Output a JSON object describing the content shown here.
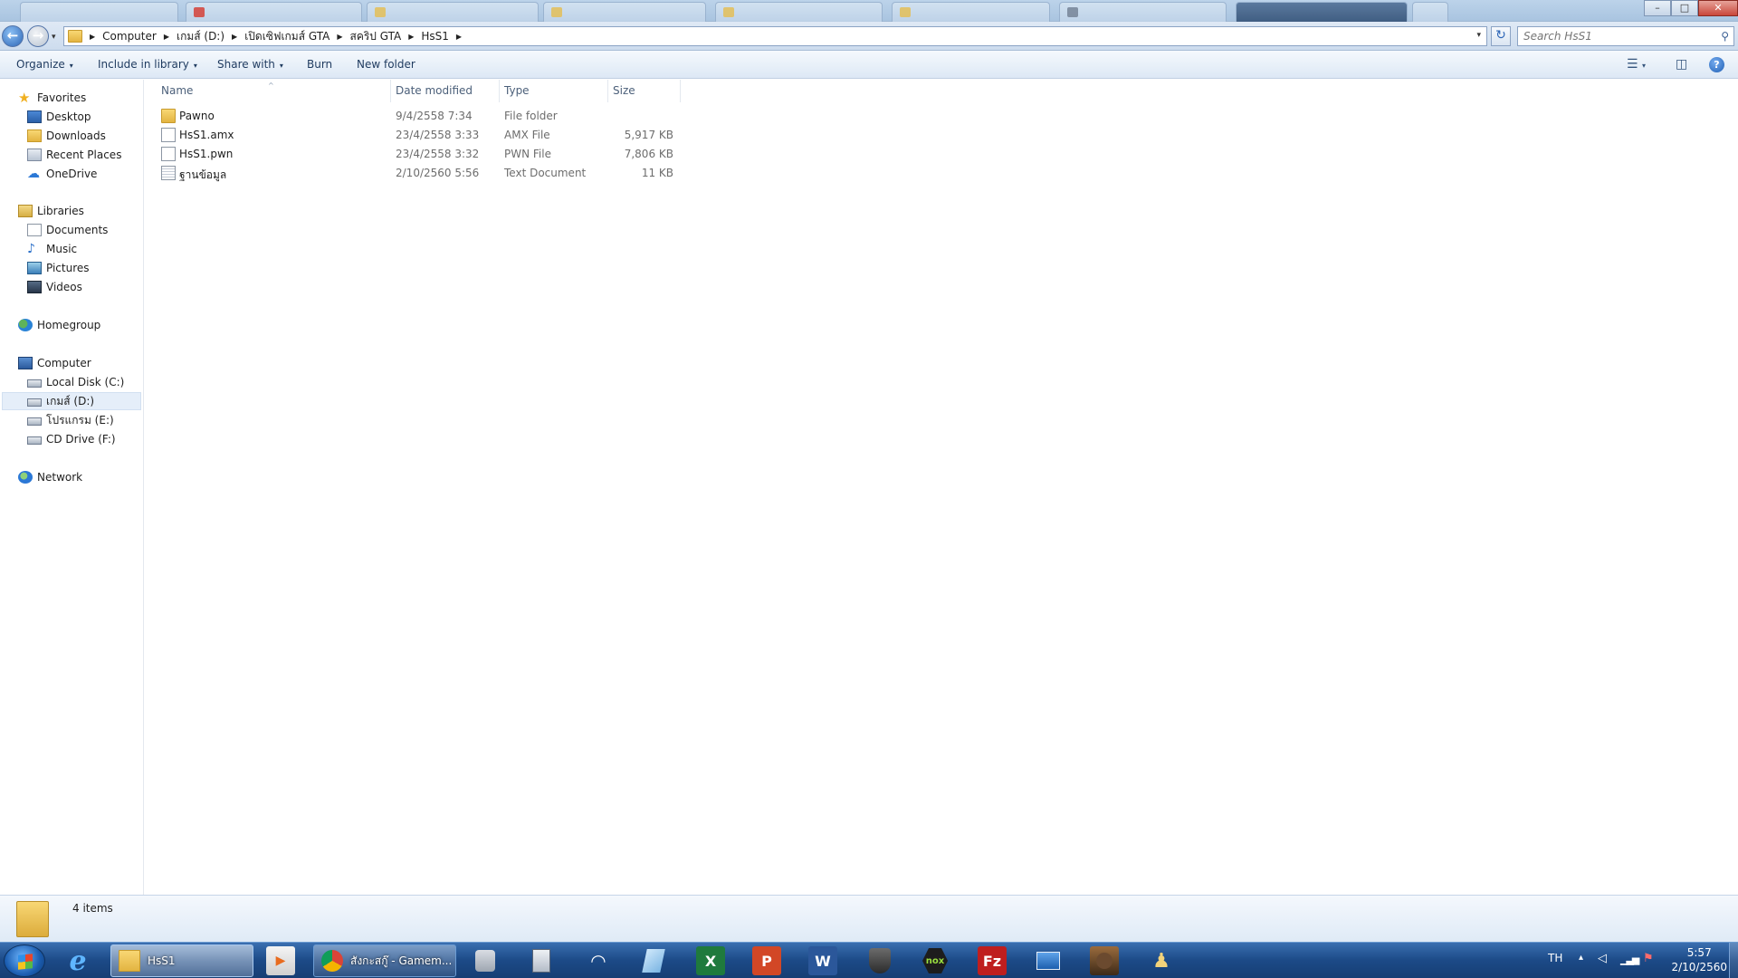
{
  "window": {
    "minimize_label": "–",
    "maximize_label": "□",
    "close_label": "✕"
  },
  "address": {
    "breadcrumbs": [
      "Computer",
      "เกมส์ (D:)",
      "เปิดเซิฟเกมส์ GTA",
      "สคริป GTA",
      "HsS1"
    ],
    "dropdown_glyph": "▾",
    "refresh_glyph": "↻",
    "recent_glyph": "▾"
  },
  "search": {
    "placeholder": "Search HsS1",
    "icon_glyph": "⚲"
  },
  "toolbar": {
    "organize": "Organize",
    "include_in_library": "Include in library",
    "share_with": "Share with",
    "burn": "Burn",
    "new_folder": "New folder",
    "caret": "▾",
    "views_glyph": "☰",
    "preview_pane_glyph": "◫",
    "help_glyph": "?"
  },
  "navpane": {
    "favorites": {
      "label": "Favorites",
      "items": [
        "Desktop",
        "Downloads",
        "Recent Places",
        "OneDrive"
      ]
    },
    "libraries": {
      "label": "Libraries",
      "items": [
        "Documents",
        "Music",
        "Pictures",
        "Videos"
      ]
    },
    "homegroup": "Homegroup",
    "computer": {
      "label": "Computer",
      "items": [
        "Local Disk (C:)",
        "เกมส์ (D:)",
        "โปรแกรม (E:)",
        "CD Drive (F:)"
      ],
      "selected_index": 1
    },
    "network": "Network"
  },
  "columns": {
    "name": "Name",
    "date_modified": "Date modified",
    "type": "Type",
    "size": "Size",
    "sort_glyph": "^"
  },
  "files": [
    {
      "name": "Pawno",
      "date": "9/4/2558 7:34",
      "type": "File folder",
      "size": "",
      "icon": "folder-icon"
    },
    {
      "name": "HsS1.amx",
      "date": "23/4/2558 3:33",
      "type": "AMX File",
      "size": "5,917 KB",
      "icon": "file-icon"
    },
    {
      "name": "HsS1.pwn",
      "date": "23/4/2558 3:32",
      "type": "PWN File",
      "size": "7,806 KB",
      "icon": "file-icon"
    },
    {
      "name": "ฐานข้อมูล",
      "date": "2/10/2560 5:56",
      "type": "Text Document",
      "size": "11 KB",
      "icon": "text-document-icon"
    }
  ],
  "details": {
    "item_count": "4 items"
  },
  "taskbar": {
    "explorer_task": "HsS1",
    "chrome_task": "สังกะสกู๊ - Gamem...",
    "excel_glyph": "X",
    "powerpoint_glyph": "P",
    "word_glyph": "W",
    "nox_glyph": "nox",
    "filezilla_glyph": "Fz",
    "ie_glyph": "e"
  },
  "tray": {
    "language": "TH",
    "show_hidden_glyph": "▴",
    "clock_time": "5:57",
    "clock_date": "2/10/2560"
  },
  "colors": {
    "accent": "#2d66b7",
    "taskbar": "#1c4a87",
    "folder": "#e3b441"
  }
}
